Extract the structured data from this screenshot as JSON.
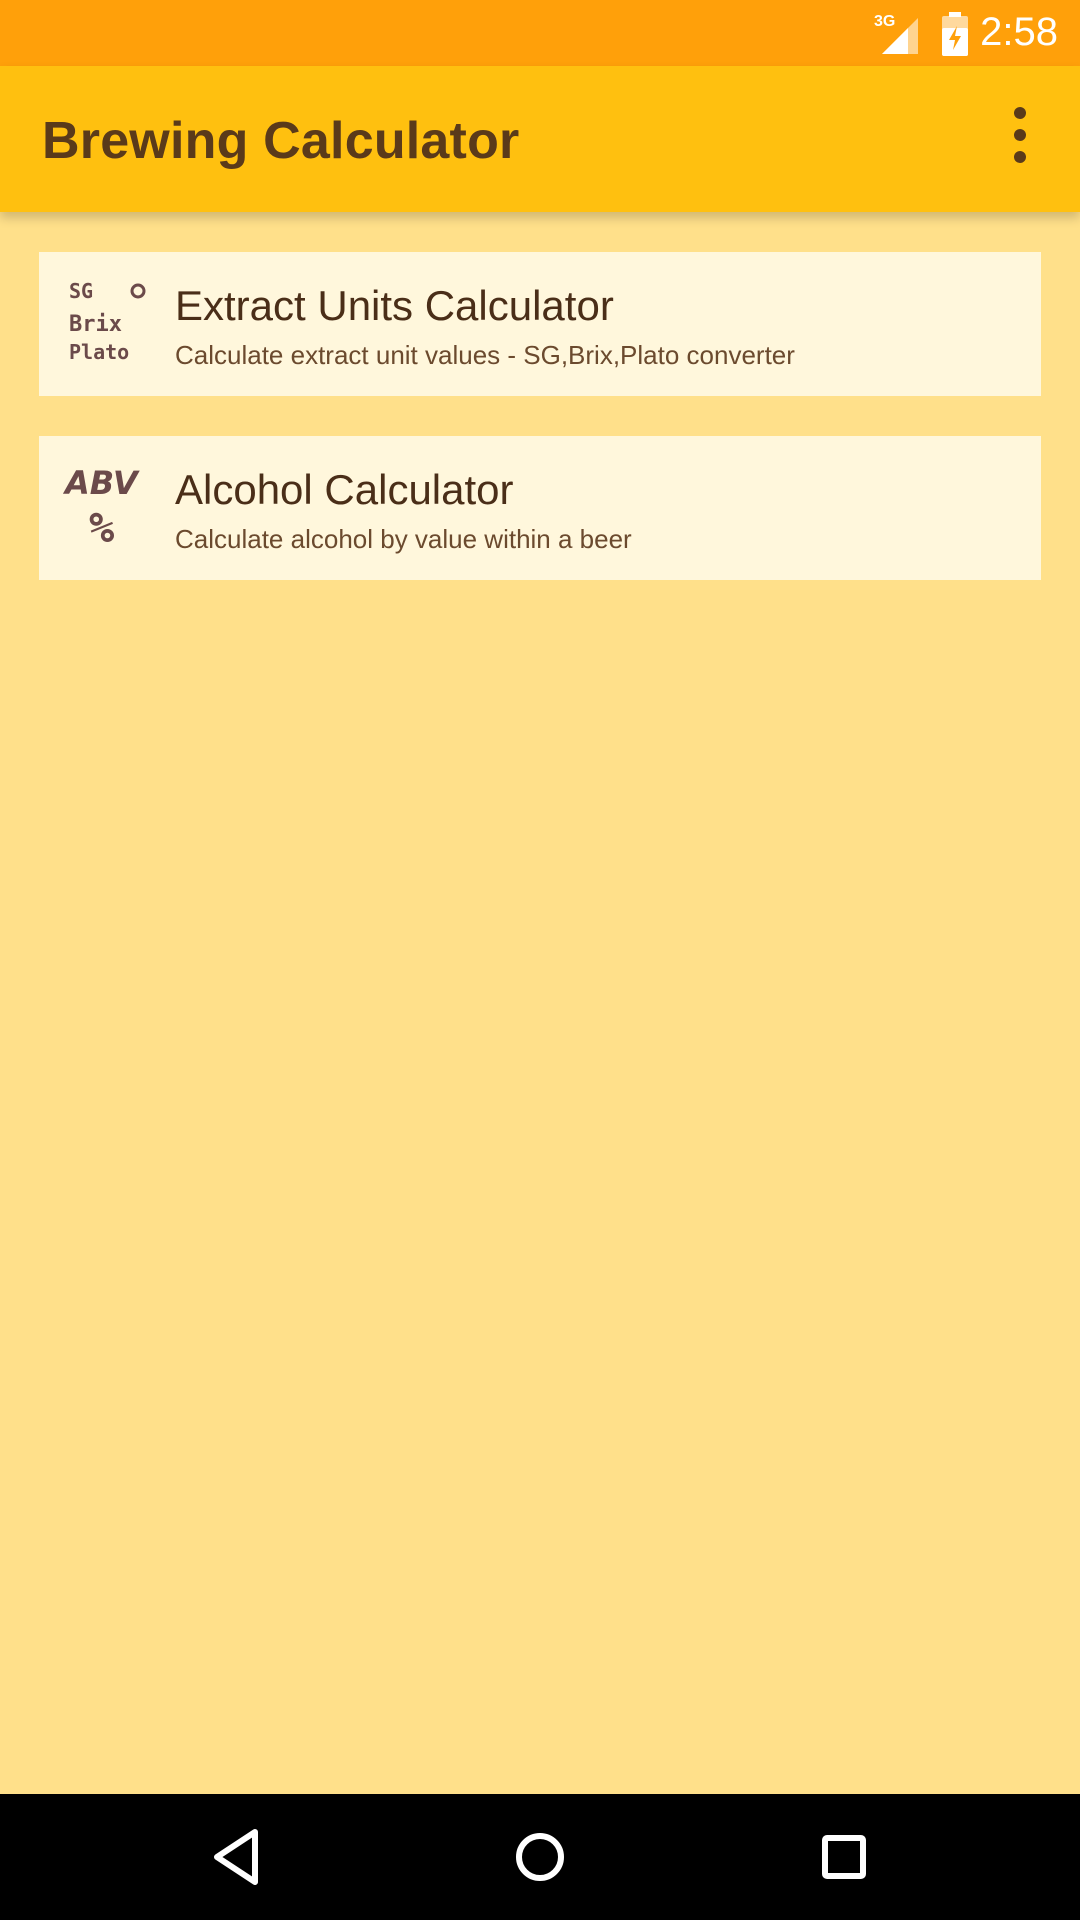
{
  "status_bar": {
    "network": "3G",
    "time": "2:58"
  },
  "app_bar": {
    "title": "Brewing Calculator",
    "menu_icon": "more-vert-icon"
  },
  "items": [
    {
      "icon_lines": [
        "SG",
        "Brix",
        "Plato"
      ],
      "icon_symbol": "°",
      "title": "Extract Units Calculator",
      "subtitle": "Calculate extract unit values - SG,Brix,Plato converter"
    },
    {
      "icon_lines": [
        "ABV",
        "%"
      ],
      "title": "Alcohol Calculator",
      "subtitle": "Calculate alcohol by value within a beer"
    }
  ],
  "nav_bar": {
    "back_icon": "back-triangle-icon",
    "home_icon": "home-circle-icon",
    "recent_icon": "recent-square-icon"
  },
  "colors": {
    "status_bar": "#FFA00A",
    "app_bar": "#FFC00F",
    "background": "#FFE08A",
    "card": "#FFF7DC",
    "text_primary": "#4A2E18",
    "icon_brown": "#6B4A4A"
  }
}
